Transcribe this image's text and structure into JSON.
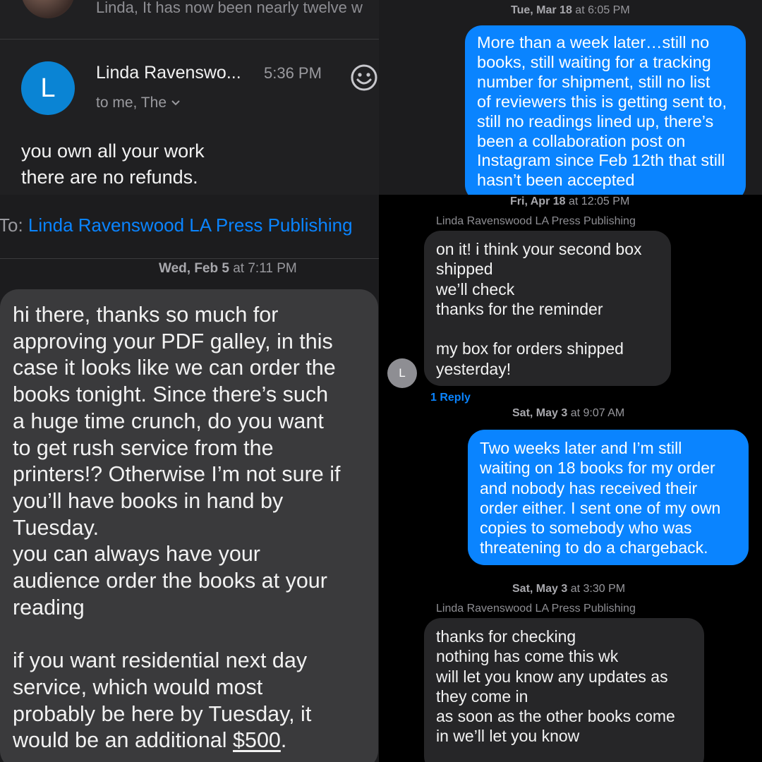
{
  "email_panel": {
    "previous_snippet": "Linda, It has now been nearly twelve w",
    "avatar_letter": "L",
    "sender": "Linda Ravenswo...",
    "time": "5:36 PM",
    "recipients": "to me, The",
    "body_lines": [
      "you own all your work",
      "there are no refunds."
    ]
  },
  "imessage_top": {
    "timestamp_day": "Tue, Mar 18",
    "timestamp_at": "at 6:05 PM",
    "sent_lines": [
      "More than a week later…still no",
      "books, still waiting for a tracking",
      "number for shipment, still no list",
      "of reviewers this is getting sent to,",
      "still no readings lined up, there’s",
      "been a collaboration post on",
      "Instagram since Feb 12th that still",
      "hasn’t been accepted"
    ]
  },
  "thread_left": {
    "to_label": "To:",
    "to_name": "Linda Ravenswood LA Press Publishing",
    "timestamp_day": "Wed, Feb 5",
    "timestamp_at": "at 7:11 PM",
    "para1_lines": [
      "hi there, thanks so much for",
      "approving your PDF galley, in this",
      "case it looks like we can order the",
      "books tonight. Since there’s such",
      "a huge time crunch, do you want",
      "to get rush service from the",
      "printers!? Otherwise I’m not sure if",
      "you’ll have books in hand by",
      "Tuesday.",
      "you can always have your",
      "audience  order the books at your",
      "reading"
    ],
    "para2_lines": [
      "if you want residential next day",
      "service, which would most",
      "probably be here by Tuesday, it"
    ],
    "last_line_start": "would be an additional ",
    "last_line_amount": "$500",
    "last_line_end": "."
  },
  "thread_right": {
    "ts1_day": "Fri, Apr 18",
    "ts1_at": "at 12:05 PM",
    "sender_name_1": "Linda Ravenswood LA Press Publishing",
    "received_1_lines_a": [
      "on it! i think your second box",
      "shipped",
      "we’ll check",
      "thanks for the reminder"
    ],
    "received_1_lines_b": [
      "my box for orders shipped",
      "yesterday!"
    ],
    "avatar_letter": "L",
    "reply_label": "1 Reply",
    "ts2_day": "Sat, May 3",
    "ts2_at": "at 9:07 AM",
    "sent_lines": [
      "Two weeks later and I’m still",
      "waiting on 18 books for my order",
      "and nobody has received their",
      "order either. I sent one of my own",
      "copies to somebody who was",
      "threatening to do a chargeback."
    ],
    "ts3_day": "Sat, May 3",
    "ts3_at": "at 3:30 PM",
    "sender_name_2": "Linda Ravenswood LA Press Publishing",
    "received_2_lines": [
      "thanks for checking",
      "nothing has come this wk",
      "will let you know any updates as",
      "they come in",
      "as soon as the other books come",
      "in we’ll let you know"
    ]
  }
}
